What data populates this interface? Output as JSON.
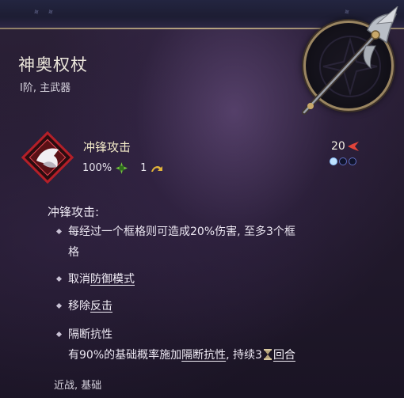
{
  "item": {
    "name": "神奥权杖",
    "subtitle": "I阶, 主武器",
    "art_icon": "halberd-icon"
  },
  "skill": {
    "name": "冲锋攻击",
    "accuracy": "100%",
    "cooldown": "1",
    "cost": "20",
    "charges": {
      "filled": 1,
      "total": 3
    },
    "icon": "charge-attack-icon"
  },
  "description": {
    "title": "冲锋攻击:",
    "bullets": [
      {
        "line1": "每经过一个框格则可造成20%伤害, 至多3个框",
        "line2": "格"
      },
      {
        "prefix": "取消",
        "link": "防御模式"
      },
      {
        "prefix": "移除",
        "link": "反击"
      },
      {
        "title": "隔断抗性",
        "pre": "有90%的基础概率施加",
        "link1": "隔断抗性",
        "mid": ", 持续3",
        "link2": "回合"
      }
    ]
  },
  "footer": {
    "tags": "近战, 基础"
  },
  "colors": {
    "accent_gold": "#9a8561",
    "panel": "#241b2f",
    "cost_red": "#e0443a",
    "pip_blue": "#bfe3ff"
  }
}
